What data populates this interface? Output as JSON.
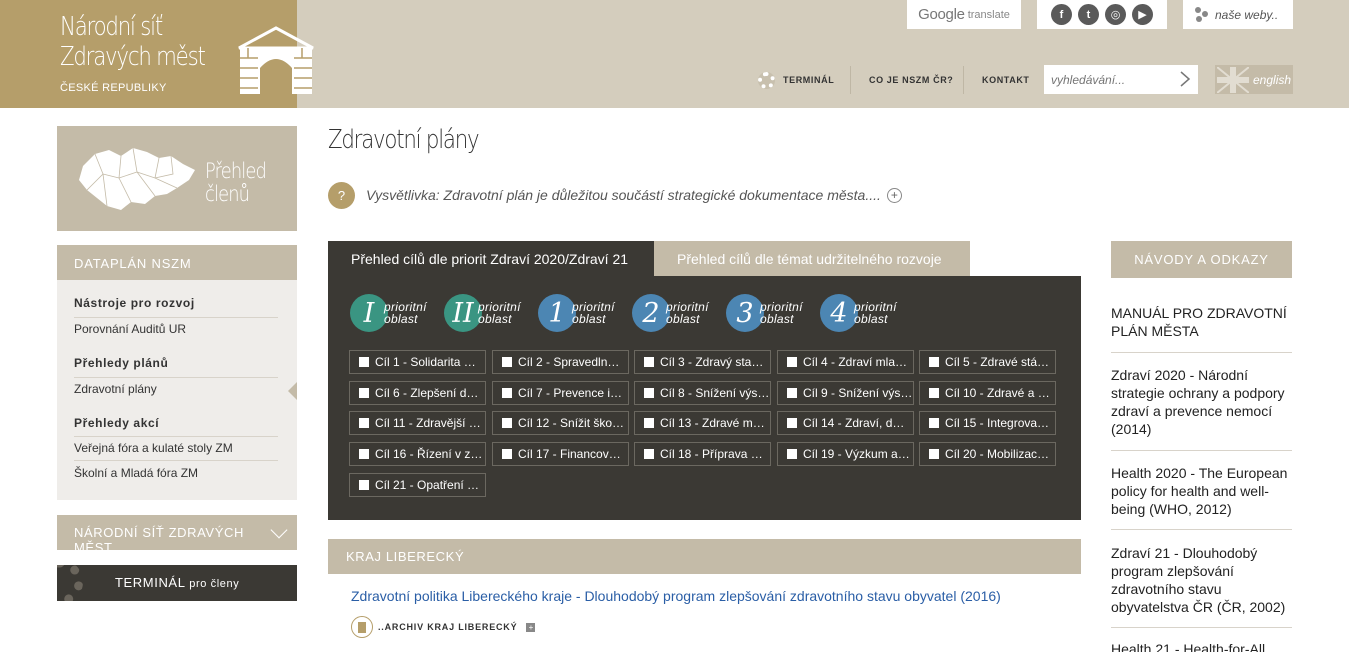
{
  "header": {
    "logo": {
      "line1": "Národní síť",
      "line2": "Zdravých měst",
      "line3": "ČESKÉ REPUBLIKY"
    },
    "google_translate": {
      "brand": "Google",
      "word": "translate"
    },
    "social": [
      "f",
      "t",
      "◎",
      "▶"
    ],
    "webs_label": "naše weby..",
    "nav": {
      "terminal": "TERMINÁL",
      "about": "CO JE NSZM ČR?",
      "contact": "KONTAKT"
    },
    "search_placeholder": "vyhledávání...",
    "lang": "english"
  },
  "sidebar": {
    "members": {
      "line1": "Přehled",
      "line2": "členů"
    },
    "dataplan_title": "DATAPLÁN NSZM",
    "items": [
      {
        "label": "Nástroje pro rozvoj",
        "group": true
      },
      {
        "label": "Porovnání Auditů UR",
        "group": false
      },
      {
        "label": "Přehledy plánů",
        "group": true
      },
      {
        "label": "Zdravotní plány",
        "group": false
      },
      {
        "label": "Přehledy akcí",
        "group": true
      },
      {
        "label": "Veřejná fóra a kulaté stoly ZM",
        "group": false
      },
      {
        "label": "Školní a Mladá fóra ZM",
        "group": false
      }
    ],
    "nsz_title": "NÁRODNÍ SÍŤ ZDRAVÝCH MĚST",
    "terminal": {
      "main": "TERMINÁL",
      "sub": "pro členy"
    }
  },
  "main": {
    "title": "Zdravotní plány",
    "explanation": "Vysvětlivka: Zdravotní plán je důležitou součástí strategické dokumentace města....",
    "tabs": [
      "Přehled cílů dle priorit Zdraví 2020/Zdraví 21",
      "Přehled cílů dle témat udržitelného rozvoje"
    ],
    "priorities": [
      {
        "num": "I",
        "word1": "prioritní",
        "word2": "oblast",
        "color": "#3a9582"
      },
      {
        "num": "II",
        "word1": "prioritní",
        "word2": "oblast",
        "color": "#3a9582"
      },
      {
        "num": "1",
        "word1": "prioritní",
        "word2": "oblast",
        "color": "#4c86b3"
      },
      {
        "num": "2",
        "word1": "prioritní",
        "word2": "oblast",
        "color": "#4c86b3"
      },
      {
        "num": "3",
        "word1": "prioritní",
        "word2": "oblast",
        "color": "#4c86b3"
      },
      {
        "num": "4",
        "word1": "prioritní",
        "word2": "oblast",
        "color": "#4c86b3"
      }
    ],
    "goals": [
      "Cíl 1 - Solidarita …",
      "Cíl 2 - Spravedln…",
      "Cíl 3 - Zdravý sta…",
      "Cíl 4 - Zdraví mla…",
      "Cíl 5 - Zdravé stá…",
      "Cíl 6 - Zlepšení d…",
      "Cíl 7 - Prevence i…",
      "Cíl 8 - Snížení výs…",
      "Cíl 9 - Snížení výs…",
      "Cíl 10 - Zdravé a …",
      "Cíl 11 - Zdravější …",
      "Cíl 12 - Snížit ško…",
      "Cíl 13 - Zdravé m…",
      "Cíl 14 - Zdraví, d…",
      "Cíl 15 - Integrova…",
      "Cíl 16 - Řízení v z…",
      "Cíl 17 - Financov…",
      "Cíl 18 - Příprava …",
      "Cíl 19 - Výzkum a…",
      "Cíl 20 - Mobilizac…",
      "Cíl 21 - Opatření …"
    ],
    "region": "KRAJ LIBERECKÝ",
    "doc_link": "Zdravotní politika Libereckého kraje - Dlouhodobý program zlepšování zdravotního stavu obyvatel (2016)",
    "archive": "..ARCHIV KRAJ LIBERECKÝ"
  },
  "right": {
    "title": "NÁVODY A ODKAZY",
    "links": [
      "MANUÁL PRO ZDRAVOTNÍ PLÁN MĚSTA",
      "Zdraví 2020 - Národní strategie ochrany a podpory zdraví a prevence nemocí (2014)",
      "Health 2020 - The European policy for health and well-being (WHO, 2012)",
      "Zdraví 21 - Dlouhodobý program zlepšování zdravotního stavu obyvatelstva ČR (ČR, 2002)",
      "Health 21 - Health-for-All"
    ]
  },
  "colors": {
    "gold": "#b59e6a",
    "beige": "#c4bba8",
    "header_bg": "#d4cdbd",
    "dark_panel": "#3b3934",
    "link_blue": "#2a5ea6",
    "green_circle": "#3a9582",
    "blue_circle": "#4c86b3"
  }
}
